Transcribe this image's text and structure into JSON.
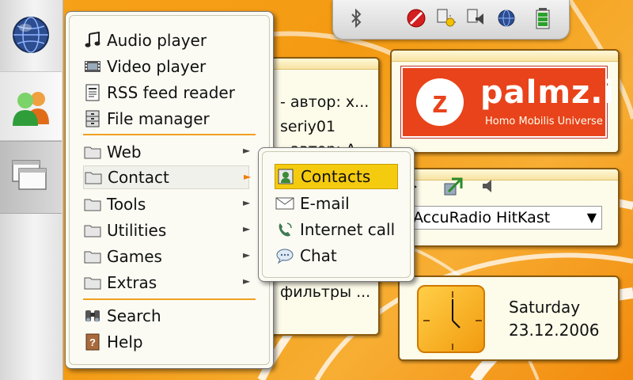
{
  "main_menu": {
    "items": [
      {
        "label": "Audio player",
        "icon": "music-note-icon"
      },
      {
        "label": "Video player",
        "icon": "film-icon"
      },
      {
        "label": "RSS feed reader",
        "icon": "rss-document-icon"
      },
      {
        "label": "File manager",
        "icon": "filing-cabinet-icon"
      }
    ],
    "folders": [
      {
        "label": "Web"
      },
      {
        "label": "Contact"
      },
      {
        "label": "Tools"
      },
      {
        "label": "Utilities"
      },
      {
        "label": "Games"
      },
      {
        "label": "Extras"
      }
    ],
    "bottom": [
      {
        "label": "Search",
        "icon": "binoculars-icon"
      },
      {
        "label": "Help",
        "icon": "help-book-icon"
      }
    ],
    "submenu_arrow": "►"
  },
  "sub_menu": {
    "items": [
      {
        "label": "Contacts",
        "icon": "contacts-icon"
      },
      {
        "label": "E-mail",
        "icon": "envelope-icon"
      },
      {
        "label": "Internet call",
        "icon": "phone-icon"
      },
      {
        "label": "Chat",
        "icon": "chat-bubble-icon"
      }
    ]
  },
  "rss_applet": {
    "lines": [
      "- автор: х...",
      "seriy01",
      "- автор: А...",
      "фильтры ..."
    ]
  },
  "ad_applet": {
    "logo_letter": "z",
    "title": "palmz.in",
    "subtitle": "Homo Mobilis Universe"
  },
  "radio_applet": {
    "station": "AccuRadio HitKast",
    "dropdown_arrow": "▼"
  },
  "clock_applet": {
    "day": "Saturday",
    "date": "23.12.2006"
  },
  "colors": {
    "desktop_orange": "#f7a21a",
    "selection_yellow": "#f5cb10",
    "separator_orange": "#f0a020",
    "ad_red": "#e8431b"
  }
}
